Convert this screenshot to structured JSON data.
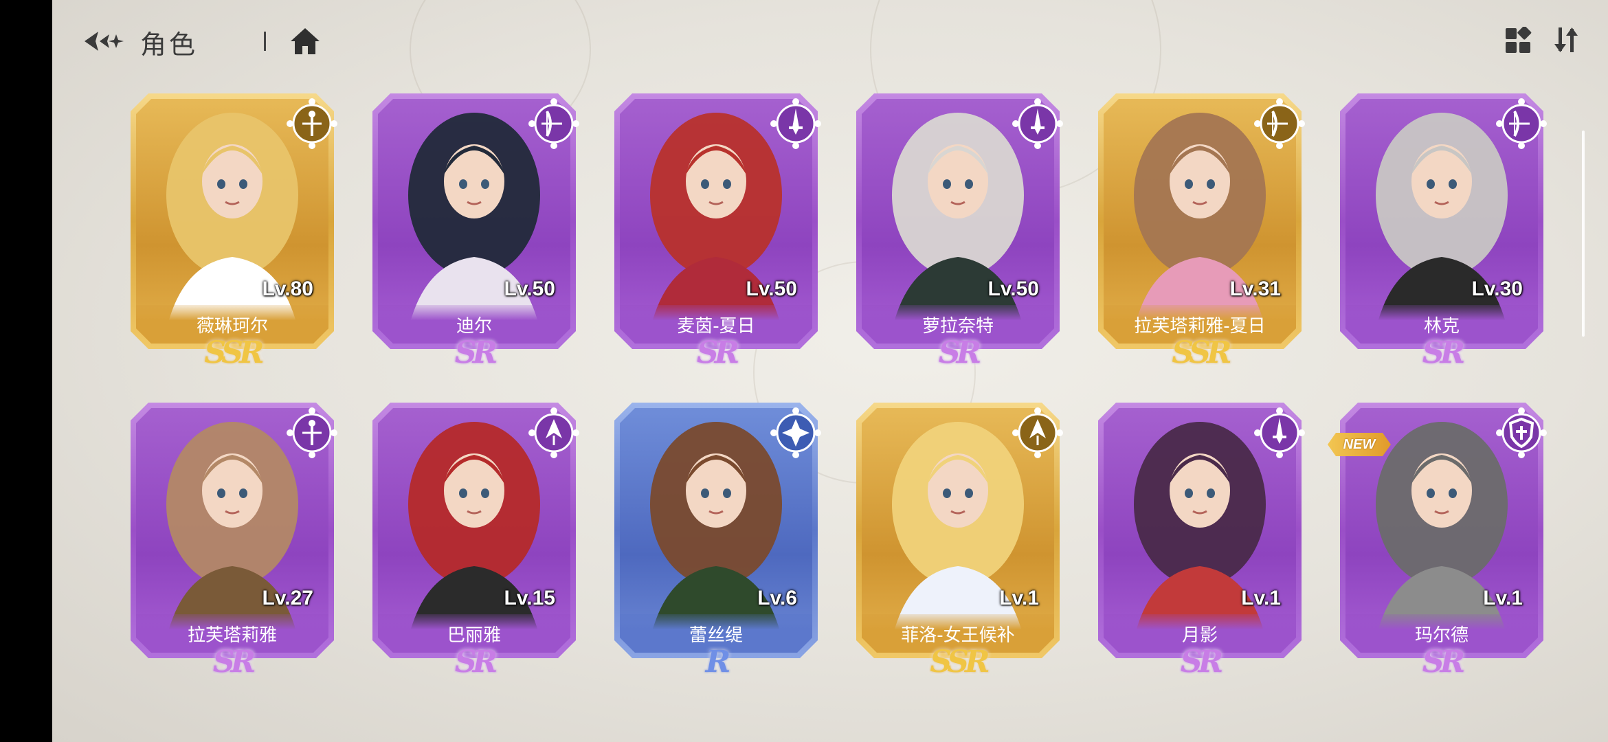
{
  "header": {
    "title": "角色",
    "back_icon": "back-arrow-icon",
    "home_icon": "home-icon",
    "view_toggle_icon": "grid-view-icon",
    "sort_icon": "sort-icon"
  },
  "colors": {
    "purple_frame": "#9a4fc7",
    "gold_frame": "#d9a53b",
    "blue_frame": "#5b77c9",
    "background": "#e9e6df"
  },
  "characters": [
    {
      "name": "薇琳珂尔",
      "level": "Lv.80",
      "rarity": "SSR",
      "frame": "gold",
      "class_icon": "staff-class-icon"
    },
    {
      "name": "迪尔",
      "level": "Lv.50",
      "rarity": "SR",
      "frame": "purple",
      "class_icon": "bow-class-icon"
    },
    {
      "name": "麦茵-夏日",
      "level": "Lv.50",
      "rarity": "SR",
      "frame": "purple",
      "class_icon": "dagger-class-icon"
    },
    {
      "name": "萝拉奈特",
      "level": "Lv.50",
      "rarity": "SR",
      "frame": "purple",
      "class_icon": "dagger-class-icon"
    },
    {
      "name": "拉芙塔莉雅-夏日",
      "level": "Lv.31",
      "rarity": "SSR",
      "frame": "gold",
      "class_icon": "bow-class-icon"
    },
    {
      "name": "林克",
      "level": "Lv.30",
      "rarity": "SR",
      "frame": "purple",
      "class_icon": "bow-class-icon"
    },
    {
      "name": "拉芙塔莉雅",
      "level": "Lv.27",
      "rarity": "SR",
      "frame": "purple",
      "class_icon": "staff-class-icon"
    },
    {
      "name": "巴丽雅",
      "level": "Lv.15",
      "rarity": "SR",
      "frame": "purple",
      "class_icon": "magic-class-icon"
    },
    {
      "name": "蕾丝缇",
      "level": "Lv.6",
      "rarity": "R",
      "frame": "blue",
      "class_icon": "healer-class-icon"
    },
    {
      "name": "菲洛-女王候补",
      "level": "Lv.1",
      "rarity": "SSR",
      "frame": "gold",
      "class_icon": "magic-class-icon"
    },
    {
      "name": "月影",
      "level": "Lv.1",
      "rarity": "SR",
      "frame": "purple",
      "class_icon": "dagger-class-icon"
    },
    {
      "name": "玛尔德",
      "level": "Lv.1",
      "rarity": "SR",
      "frame": "purple",
      "class_icon": "shield-class-icon",
      "new_tag": "NEW"
    }
  ]
}
